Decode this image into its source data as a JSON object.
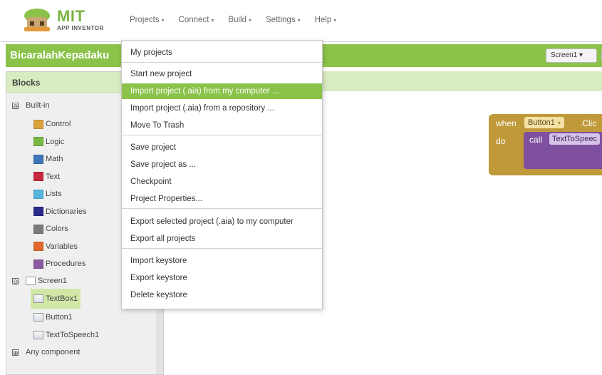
{
  "app": {
    "logo_main": "MIT",
    "logo_sub": "APP INVENTOR"
  },
  "nav": {
    "projects": "Projects",
    "connect": "Connect",
    "build": "Build",
    "settings": "Settings",
    "help": "Help",
    "caret": "▾"
  },
  "project": {
    "name": "BicaralahKepadaku",
    "screen_select": "Screen1 ▾"
  },
  "blocks": {
    "title": "Blocks",
    "builtin_label": "Built-in",
    "builtin_toggle": "⊖",
    "builtin_items": [
      {
        "label": "Control",
        "color": "#d9a23a"
      },
      {
        "label": "Logic",
        "color": "#77b843"
      },
      {
        "label": "Math",
        "color": "#3d76b8"
      },
      {
        "label": "Text",
        "color": "#c8283d"
      },
      {
        "label": "Lists",
        "color": "#56b5de"
      },
      {
        "label": "Dictionaries",
        "color": "#2a2a8a"
      },
      {
        "label": "Colors",
        "color": "#7a7a7a"
      },
      {
        "label": "Variables",
        "color": "#e2692a"
      },
      {
        "label": "Procedures",
        "color": "#8a5a9e"
      }
    ],
    "screen_label": "Screen1",
    "screen_toggle": "⊖",
    "components": [
      {
        "label": "TextBox1",
        "icon": "textbox-icon"
      },
      {
        "label": "Button1",
        "icon": "button-icon"
      },
      {
        "label": "TextToSpeech1",
        "icon": "text-to-speech-icon"
      }
    ],
    "any_component_label": "Any component",
    "any_toggle": "⊕"
  },
  "menu": {
    "items": [
      "My projects",
      "Start new project",
      "Import project (.aia) from my computer ...",
      "Import project (.aia) from a repository ...",
      "Move To Trash",
      "Save project",
      "Save project as ...",
      "Checkpoint",
      "Project Properties...",
      "Export selected project (.aia) to my computer",
      "Export all projects",
      "Import keystore",
      "Export keystore",
      "Delete keystore"
    ],
    "highlighted_index": 2
  },
  "block_editor": {
    "when": "when",
    "button_name": "Button1",
    "dropdown": "▾",
    "click": ".Clic",
    "do": "do",
    "call": "call",
    "call_name": "TextToSpeec"
  },
  "colors": {
    "accent_green": "#8bc34a",
    "event_block": "#c09a3a",
    "call_block": "#7e4f9e"
  }
}
